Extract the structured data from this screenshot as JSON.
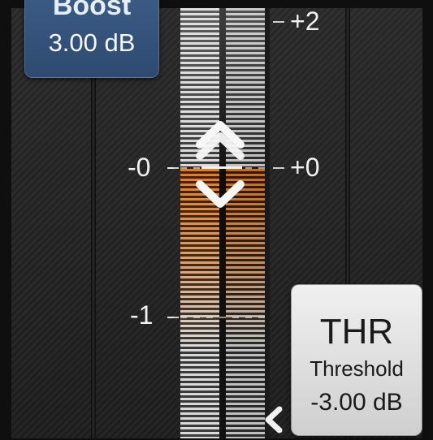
{
  "boost": {
    "title": "Boost",
    "value": "3.00 dB"
  },
  "meter": {
    "labels": {
      "right_top": "+2",
      "right_mid": "+0",
      "left_mid": "-0",
      "left_low": "-1"
    }
  },
  "threshold": {
    "title": "THR",
    "subtitle": "Threshold",
    "value": "-3.00 dB"
  }
}
